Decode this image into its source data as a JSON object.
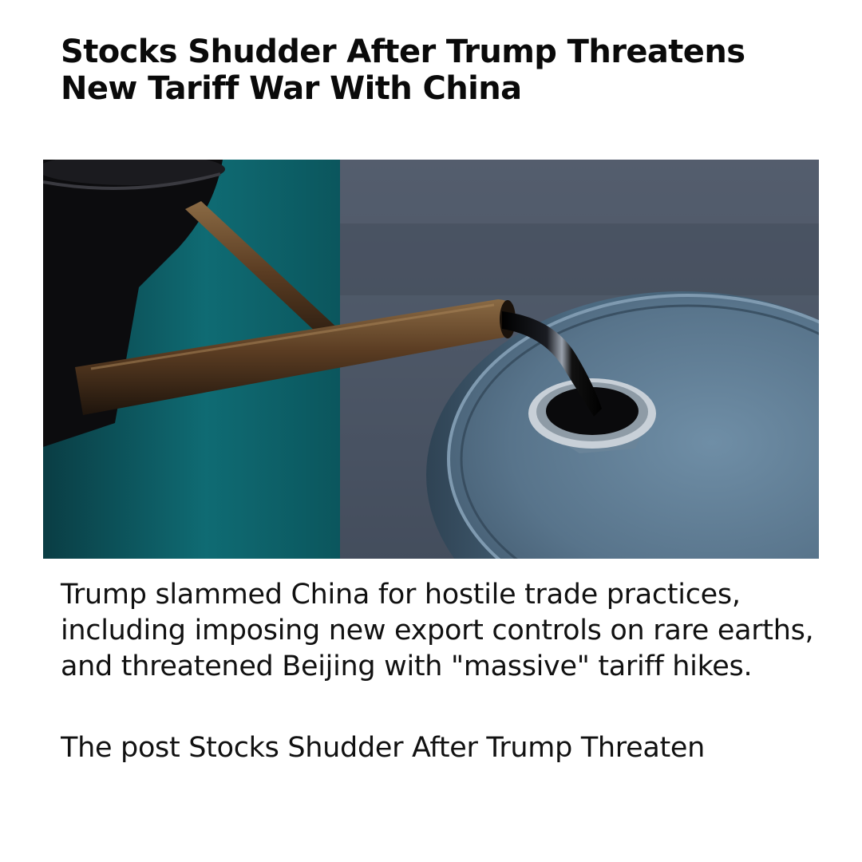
{
  "article": {
    "headline": "Stocks Shudder After Trump Threatens New Tariff War With China",
    "summary": "Trump slammed China for hostile trade practices, including imposing new export controls on rare earths, and threatened Beijing with \"massive\" tariff hikes.",
    "source_line": "The post Stocks Shudder After Trump Threaten"
  },
  "photo": {
    "subject": "oil-pouring-into-barrel",
    "colors": {
      "background_teal": "#0f6b73",
      "background_slate": "#4a5563",
      "spout_rust": "#6a4a2c",
      "barrel_blue": "#5f7c93",
      "oil": "#0d0d10"
    }
  }
}
